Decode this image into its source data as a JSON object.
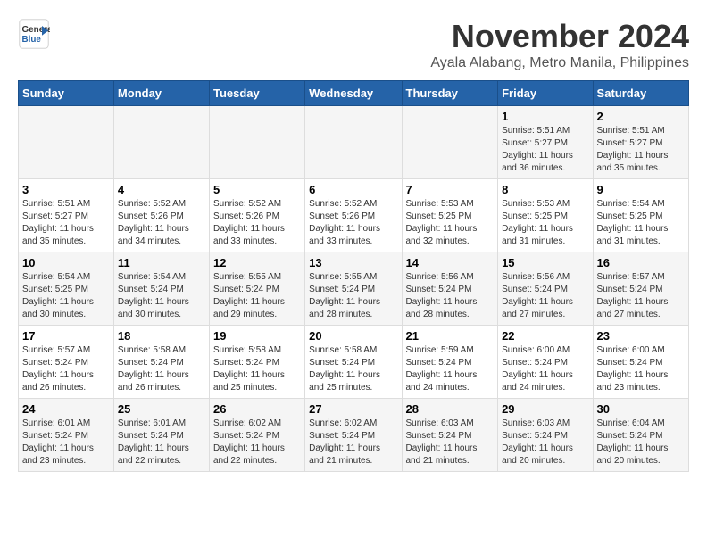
{
  "header": {
    "logo_line1": "General",
    "logo_line2": "Blue",
    "month": "November 2024",
    "location": "Ayala Alabang, Metro Manila, Philippines"
  },
  "weekdays": [
    "Sunday",
    "Monday",
    "Tuesday",
    "Wednesday",
    "Thursday",
    "Friday",
    "Saturday"
  ],
  "weeks": [
    [
      {
        "day": "",
        "info": ""
      },
      {
        "day": "",
        "info": ""
      },
      {
        "day": "",
        "info": ""
      },
      {
        "day": "",
        "info": ""
      },
      {
        "day": "",
        "info": ""
      },
      {
        "day": "1",
        "info": "Sunrise: 5:51 AM\nSunset: 5:27 PM\nDaylight: 11 hours\nand 36 minutes."
      },
      {
        "day": "2",
        "info": "Sunrise: 5:51 AM\nSunset: 5:27 PM\nDaylight: 11 hours\nand 35 minutes."
      }
    ],
    [
      {
        "day": "3",
        "info": "Sunrise: 5:51 AM\nSunset: 5:27 PM\nDaylight: 11 hours\nand 35 minutes."
      },
      {
        "day": "4",
        "info": "Sunrise: 5:52 AM\nSunset: 5:26 PM\nDaylight: 11 hours\nand 34 minutes."
      },
      {
        "day": "5",
        "info": "Sunrise: 5:52 AM\nSunset: 5:26 PM\nDaylight: 11 hours\nand 33 minutes."
      },
      {
        "day": "6",
        "info": "Sunrise: 5:52 AM\nSunset: 5:26 PM\nDaylight: 11 hours\nand 33 minutes."
      },
      {
        "day": "7",
        "info": "Sunrise: 5:53 AM\nSunset: 5:25 PM\nDaylight: 11 hours\nand 32 minutes."
      },
      {
        "day": "8",
        "info": "Sunrise: 5:53 AM\nSunset: 5:25 PM\nDaylight: 11 hours\nand 31 minutes."
      },
      {
        "day": "9",
        "info": "Sunrise: 5:54 AM\nSunset: 5:25 PM\nDaylight: 11 hours\nand 31 minutes."
      }
    ],
    [
      {
        "day": "10",
        "info": "Sunrise: 5:54 AM\nSunset: 5:25 PM\nDaylight: 11 hours\nand 30 minutes."
      },
      {
        "day": "11",
        "info": "Sunrise: 5:54 AM\nSunset: 5:24 PM\nDaylight: 11 hours\nand 30 minutes."
      },
      {
        "day": "12",
        "info": "Sunrise: 5:55 AM\nSunset: 5:24 PM\nDaylight: 11 hours\nand 29 minutes."
      },
      {
        "day": "13",
        "info": "Sunrise: 5:55 AM\nSunset: 5:24 PM\nDaylight: 11 hours\nand 28 minutes."
      },
      {
        "day": "14",
        "info": "Sunrise: 5:56 AM\nSunset: 5:24 PM\nDaylight: 11 hours\nand 28 minutes."
      },
      {
        "day": "15",
        "info": "Sunrise: 5:56 AM\nSunset: 5:24 PM\nDaylight: 11 hours\nand 27 minutes."
      },
      {
        "day": "16",
        "info": "Sunrise: 5:57 AM\nSunset: 5:24 PM\nDaylight: 11 hours\nand 27 minutes."
      }
    ],
    [
      {
        "day": "17",
        "info": "Sunrise: 5:57 AM\nSunset: 5:24 PM\nDaylight: 11 hours\nand 26 minutes."
      },
      {
        "day": "18",
        "info": "Sunrise: 5:58 AM\nSunset: 5:24 PM\nDaylight: 11 hours\nand 26 minutes."
      },
      {
        "day": "19",
        "info": "Sunrise: 5:58 AM\nSunset: 5:24 PM\nDaylight: 11 hours\nand 25 minutes."
      },
      {
        "day": "20",
        "info": "Sunrise: 5:58 AM\nSunset: 5:24 PM\nDaylight: 11 hours\nand 25 minutes."
      },
      {
        "day": "21",
        "info": "Sunrise: 5:59 AM\nSunset: 5:24 PM\nDaylight: 11 hours\nand 24 minutes."
      },
      {
        "day": "22",
        "info": "Sunrise: 6:00 AM\nSunset: 5:24 PM\nDaylight: 11 hours\nand 24 minutes."
      },
      {
        "day": "23",
        "info": "Sunrise: 6:00 AM\nSunset: 5:24 PM\nDaylight: 11 hours\nand 23 minutes."
      }
    ],
    [
      {
        "day": "24",
        "info": "Sunrise: 6:01 AM\nSunset: 5:24 PM\nDaylight: 11 hours\nand 23 minutes."
      },
      {
        "day": "25",
        "info": "Sunrise: 6:01 AM\nSunset: 5:24 PM\nDaylight: 11 hours\nand 22 minutes."
      },
      {
        "day": "26",
        "info": "Sunrise: 6:02 AM\nSunset: 5:24 PM\nDaylight: 11 hours\nand 22 minutes."
      },
      {
        "day": "27",
        "info": "Sunrise: 6:02 AM\nSunset: 5:24 PM\nDaylight: 11 hours\nand 21 minutes."
      },
      {
        "day": "28",
        "info": "Sunrise: 6:03 AM\nSunset: 5:24 PM\nDaylight: 11 hours\nand 21 minutes."
      },
      {
        "day": "29",
        "info": "Sunrise: 6:03 AM\nSunset: 5:24 PM\nDaylight: 11 hours\nand 20 minutes."
      },
      {
        "day": "30",
        "info": "Sunrise: 6:04 AM\nSunset: 5:24 PM\nDaylight: 11 hours\nand 20 minutes."
      }
    ]
  ]
}
